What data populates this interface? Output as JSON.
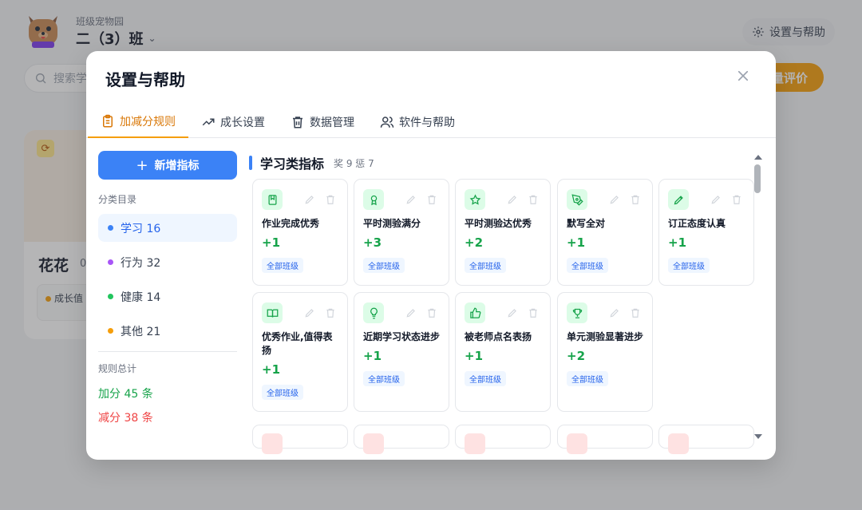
{
  "app": {
    "subtitle": "班级宠物园",
    "class_name": "二（3）班",
    "settings_label": "设置与帮助",
    "search_placeholder": "搜索学",
    "batch_label": "量评价",
    "pet_name": "花花",
    "pet_level": "0",
    "growth_label": "成长值"
  },
  "modal": {
    "title": "设置与帮助",
    "tabs": [
      {
        "label": "加减分规则",
        "active": true,
        "icon": "clipboard-icon"
      },
      {
        "label": "成长设置",
        "active": false,
        "icon": "trending-up-icon"
      },
      {
        "label": "数据管理",
        "active": false,
        "icon": "trash-icon"
      },
      {
        "label": "软件与帮助",
        "active": false,
        "icon": "users-icon"
      }
    ]
  },
  "sidebar": {
    "add_label": "新增指标",
    "category_title": "分类目录",
    "categories": [
      {
        "label": "学习 16",
        "color": "#3b82f6",
        "active": true
      },
      {
        "label": "行为 32",
        "color": "#a855f7",
        "active": false
      },
      {
        "label": "健康 14",
        "color": "#22c55e",
        "active": false
      },
      {
        "label": "其他 21",
        "color": "#f59e0b",
        "active": false
      }
    ],
    "stats_title": "规则总计",
    "plus_stat": "加分 45 条",
    "minus_stat": "减分 38 条"
  },
  "main": {
    "group_title": "学习类指标",
    "group_sub": "奖 9 惩 7",
    "rules": [
      {
        "name": "作业完成优秀",
        "points": "+1",
        "tag": "全部班级",
        "icon": "book-icon"
      },
      {
        "name": "平时测验满分",
        "points": "+3",
        "tag": "全部班级",
        "icon": "award-icon"
      },
      {
        "name": "平时测验达优秀",
        "points": "+2",
        "tag": "全部班级",
        "icon": "star-icon"
      },
      {
        "name": "默写全对",
        "points": "+1",
        "tag": "全部班级",
        "icon": "pen-tool-icon"
      },
      {
        "name": "订正态度认真",
        "points": "+1",
        "tag": "全部班级",
        "icon": "pencil-icon"
      },
      {
        "name": "优秀作业,值得表扬",
        "points": "+1",
        "tag": "全部班级",
        "icon": "open-book-icon"
      },
      {
        "name": "近期学习状态进步",
        "points": "+1",
        "tag": "全部班级",
        "icon": "lightbulb-icon"
      },
      {
        "name": "被老师点名表扬",
        "points": "+1",
        "tag": "全部班级",
        "icon": "thumbs-up-icon"
      },
      {
        "name": "单元测验显著进步",
        "points": "+2",
        "tag": "全部班级",
        "icon": "trophy-icon"
      }
    ]
  }
}
